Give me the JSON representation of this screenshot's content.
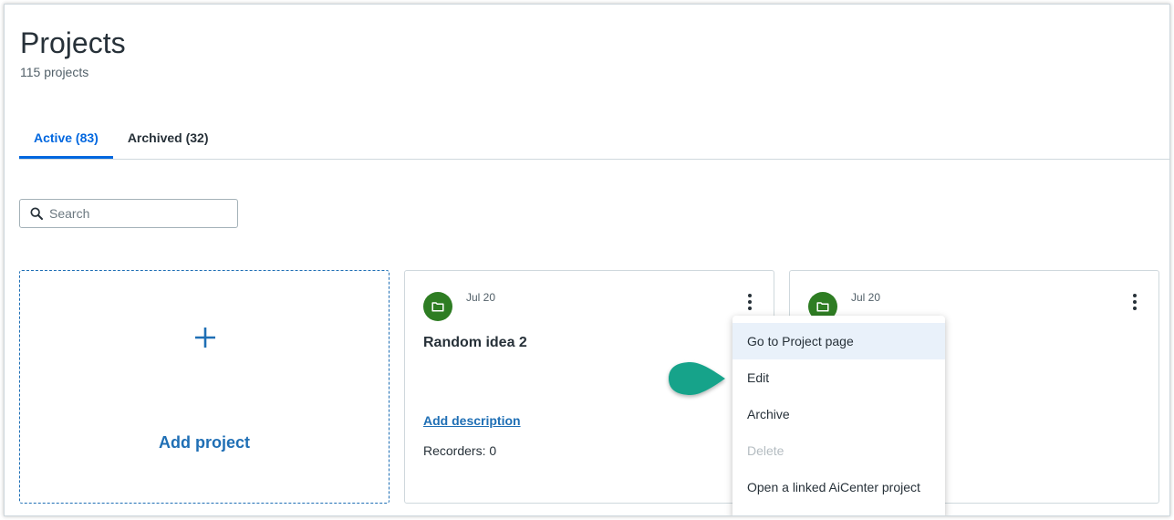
{
  "header": {
    "title": "Projects",
    "subtitle": "115 projects"
  },
  "tabs": [
    {
      "label": "Active (83)",
      "active": true
    },
    {
      "label": "Archived (32)",
      "active": false
    }
  ],
  "search": {
    "placeholder": "Search",
    "value": ""
  },
  "add_card": {
    "icon": "plus-icon",
    "label": "Add project"
  },
  "cards": [
    {
      "date": "Jul 20",
      "name": "Random idea 2",
      "add_description": "Add description",
      "recorders": "Recorders: 0",
      "icon": "folder-icon"
    },
    {
      "date": "Jul 20",
      "icon": "folder-icon"
    }
  ],
  "context_menu": {
    "items": [
      {
        "label": "Go to Project page",
        "state": "hover"
      },
      {
        "label": "Edit",
        "state": "normal"
      },
      {
        "label": "Archive",
        "state": "normal"
      },
      {
        "label": "Delete",
        "state": "disabled"
      },
      {
        "label": "Open a linked AiCenter project",
        "state": "normal"
      }
    ]
  },
  "colors": {
    "accent": "#0067df",
    "link": "#1f6fb5",
    "folder_badge": "#2e7d23",
    "pointer": "#13a38a",
    "menu_hover": "#e9f1fa"
  }
}
